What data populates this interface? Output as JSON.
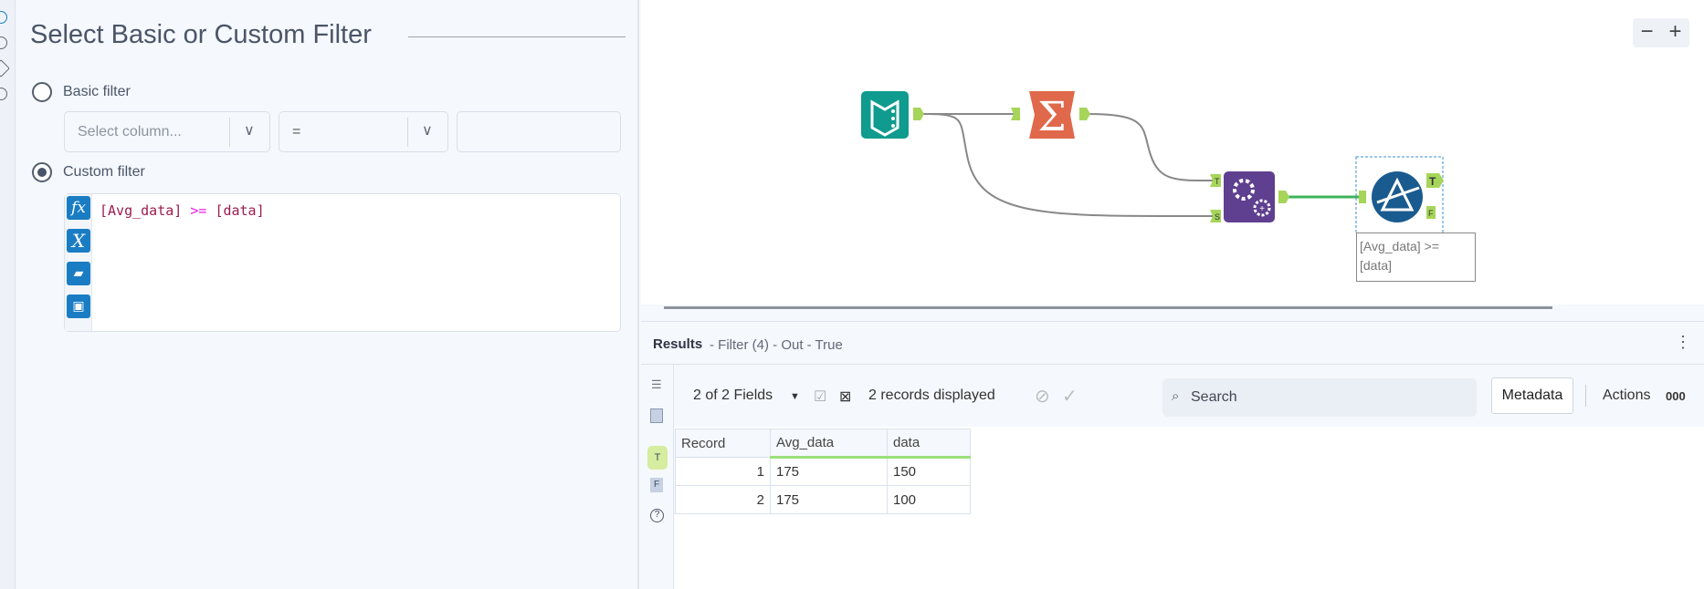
{
  "panel": {
    "title": "Select Basic or Custom Filter",
    "basic_label": "Basic filter",
    "column_placeholder": "Select column...",
    "operator": "=",
    "value": "",
    "custom_label": "Custom filter",
    "expression": {
      "left": "[Avg_data]",
      "op": ">=",
      "right": "[data]"
    },
    "editor_buttons": [
      "fx",
      "X",
      "open",
      "save"
    ]
  },
  "canvas": {
    "zoom_out": "−",
    "zoom_in": "+",
    "annotation": "[Avg_data] >= [data]",
    "join_inputs": [
      "T",
      "S"
    ],
    "filter_outputs": [
      "T",
      "F"
    ],
    "colors": {
      "input": "#0f9b8e",
      "summarize": "#e0684b",
      "app": "#5f3f8f",
      "filter": "#1a5b8f",
      "anchor": "#a6d55a"
    }
  },
  "results": {
    "title": "Results",
    "subtitle": "- Filter (4) - Out - True",
    "fields": "2 of 2 Fields",
    "records": "2 records displayed",
    "search_placeholder": "Search",
    "metadata": "Metadata",
    "actions": "Actions",
    "more": "000",
    "columns": [
      "Record",
      "Avg_data",
      "data"
    ],
    "rows": [
      [
        "1",
        "175",
        "150"
      ],
      [
        "2",
        "175",
        "100"
      ]
    ]
  }
}
